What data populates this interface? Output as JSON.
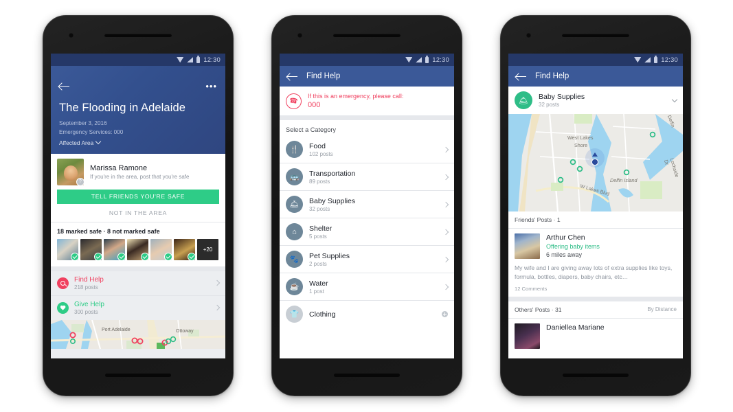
{
  "phones": [
    {
      "id": "phone-crisis-overview",
      "status_bar": {
        "time": "12:30",
        "icons": [
          "wifi-icon",
          "signal-icon",
          "battery-icon"
        ]
      },
      "app_bar": {
        "back": "back-arrow-icon",
        "overflow": "•••"
      },
      "hero": {
        "title": "The Flooding in Adelaide",
        "date": "September 3, 2016",
        "emergency_services": "Emergency Services: 000",
        "affected_area": "Affected Area"
      },
      "user_card": {
        "name": "Marissa Ramone",
        "prompt": "If you're in the area, post that you're safe",
        "badge": "?"
      },
      "safe_button": "TELL FRIENDS YOU'RE SAFE",
      "not_in_area_button": "NOT IN THE AREA",
      "safe_count": "18 marked safe · 8 not marked safe",
      "more_faces": "+20",
      "actions": [
        {
          "label": "Find Help",
          "posts": "218 posts",
          "icon": "search-icon",
          "color": "#f0405f"
        },
        {
          "label": "Give Help",
          "posts": "300 posts",
          "icon": "heart-icon",
          "color": "#2ecc87"
        }
      ],
      "map_labels": [
        "Port Adelaide",
        "Ottoway"
      ]
    },
    {
      "id": "phone-find-help-categories",
      "status_bar": {
        "time": "12:30"
      },
      "app_bar": {
        "title": "Find Help"
      },
      "emergency": {
        "text": "If this is an emergency, please call:",
        "number": "000",
        "icon": "phone-icon"
      },
      "section_header": "Select a Category",
      "categories": [
        {
          "label": "Food",
          "posts": "102 posts",
          "icon": "cutlery-icon",
          "state": "normal"
        },
        {
          "label": "Transportation",
          "posts": "89 posts",
          "icon": "bus-icon",
          "state": "normal"
        },
        {
          "label": "Baby Supplies",
          "posts": "32 posts",
          "icon": "stroller-icon",
          "state": "normal"
        },
        {
          "label": "Shelter",
          "posts": "5 posts",
          "icon": "home-icon",
          "state": "normal"
        },
        {
          "label": "Pet Supplies",
          "posts": "2 posts",
          "icon": "paw-icon",
          "state": "normal"
        },
        {
          "label": "Water",
          "posts": "1 post",
          "icon": "cup-icon",
          "state": "normal"
        },
        {
          "label": "Clothing",
          "posts": "",
          "icon": "shirt-icon",
          "state": "faded"
        }
      ]
    },
    {
      "id": "phone-baby-supplies-posts",
      "status_bar": {
        "time": "12:30"
      },
      "app_bar": {
        "title": "Find Help"
      },
      "category": {
        "label": "Baby Supplies",
        "posts": "32 posts",
        "icon": "stroller-icon"
      },
      "map_labels": [
        "West Lakes",
        "Shore",
        "Delfin Island",
        "W Lakes Blvd",
        "Lochside Dr",
        "Delfin"
      ],
      "friends_posts_header": "Friends' Posts · 1",
      "friend_post": {
        "name": "Arthur Chen",
        "offer": "Offering baby items",
        "distance": "6 miles away",
        "body": "My wife and I are giving away lots of extra supplies like toys, formula, bottles, diapers, baby chairs, etc…",
        "comments": "12 Comments"
      },
      "others_posts_header": "Others' Posts · 31",
      "sort_label": "By Distance",
      "other_post": {
        "name": "Daniellea Mariane"
      }
    }
  ],
  "colors": {
    "fb_blue": "#3b5998",
    "status_navy": "#2b3f81",
    "green": "#2ecc87",
    "red": "#f0405f",
    "slate": "#6e8799"
  }
}
